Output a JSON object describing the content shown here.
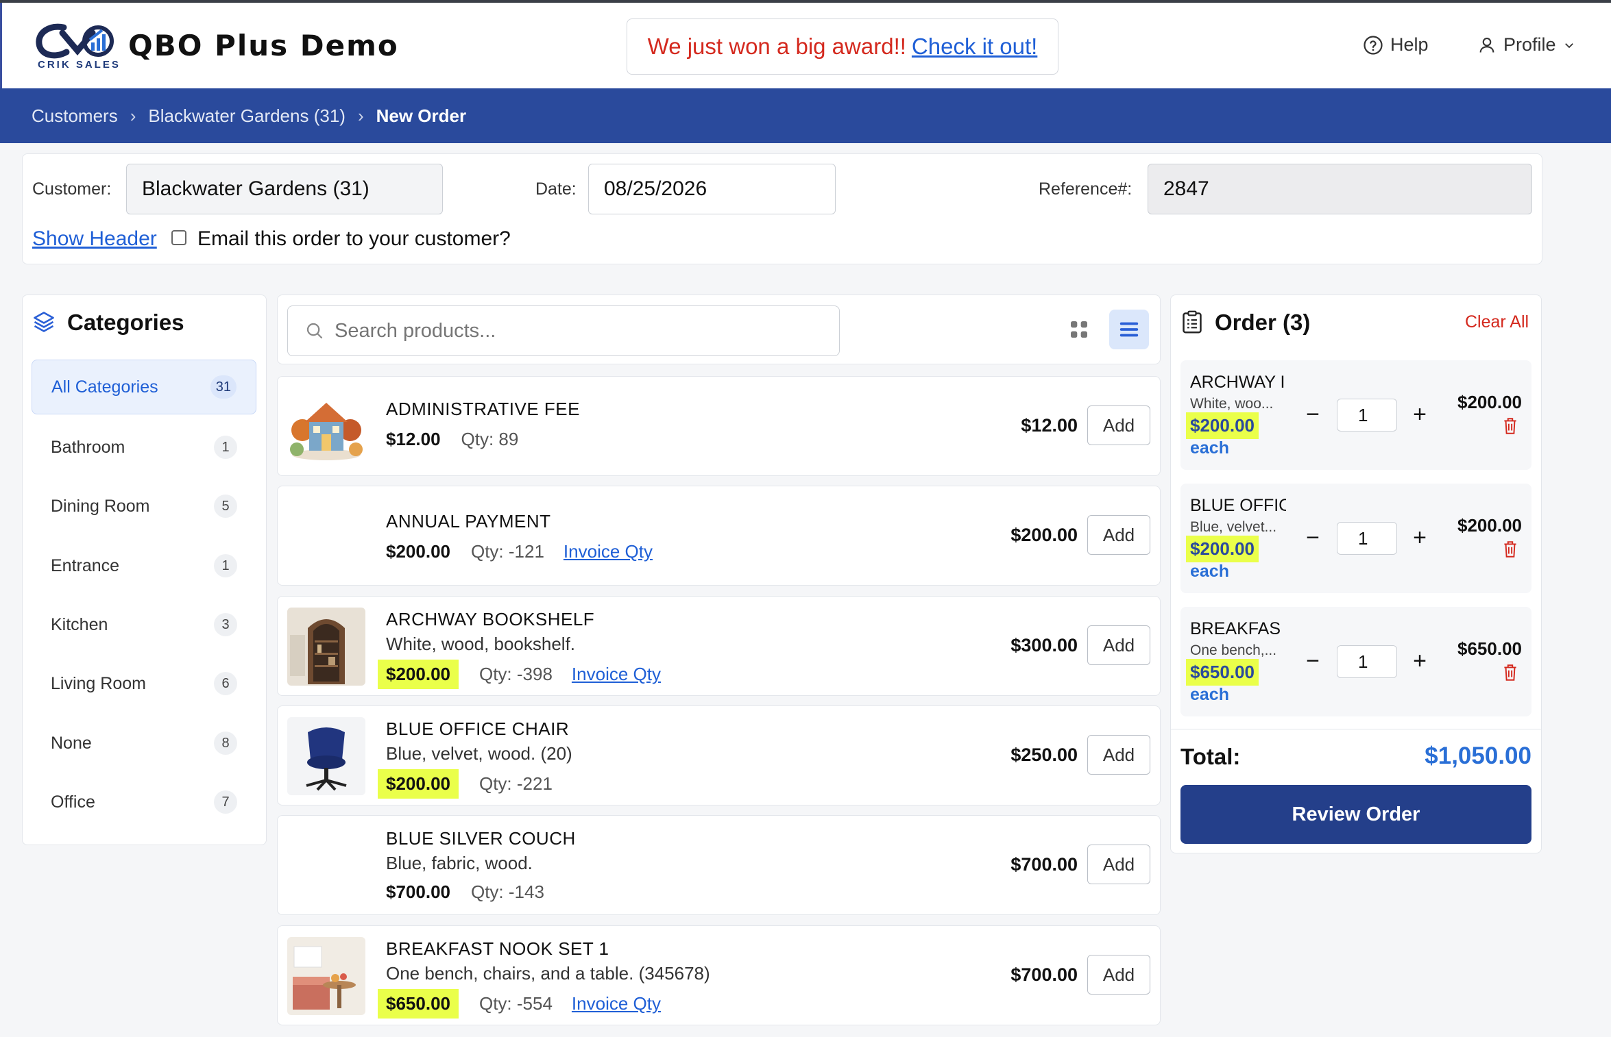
{
  "app": {
    "title": "QBO Plus Demo",
    "logo_text": "CRIK SALES",
    "award_text": "We just won a big award!!",
    "award_link": "Check it out!",
    "help_label": "Help",
    "profile_label": "Profile"
  },
  "breadcrumb": {
    "items": [
      "Customers",
      "Blackwater Gardens (31)",
      "New Order"
    ]
  },
  "order_header": {
    "customer_label": "Customer:",
    "customer_value": "Blackwater Gardens (31)",
    "date_label": "Date:",
    "date_value": "08/25/2026",
    "reference_label": "Reference#:",
    "reference_value": "2847",
    "show_header_link": "Show Header",
    "email_label": "Email this order to your customer?"
  },
  "categories": {
    "title": "Categories",
    "items": [
      {
        "label": "All Categories",
        "count": "31"
      },
      {
        "label": "Bathroom",
        "count": "1"
      },
      {
        "label": "Dining Room",
        "count": "5"
      },
      {
        "label": "Entrance",
        "count": "1"
      },
      {
        "label": "Kitchen",
        "count": "3"
      },
      {
        "label": "Living Room",
        "count": "6"
      },
      {
        "label": "None",
        "count": "8"
      },
      {
        "label": "Office",
        "count": "7"
      }
    ]
  },
  "search": {
    "placeholder": "Search products..."
  },
  "products": [
    {
      "name": "ADMINISTRATIVE FEE",
      "desc": "",
      "price": "$12.00",
      "qty": "Qty: 89",
      "invoice": "",
      "list_price": "$12.00",
      "add": "Add"
    },
    {
      "name": "ANNUAL PAYMENT",
      "desc": "",
      "price": "$200.00",
      "qty": "Qty: -121",
      "invoice": "Invoice Qty",
      "list_price": "$200.00",
      "add": "Add"
    },
    {
      "name": "ARCHWAY BOOKSHELF",
      "desc": "White, wood, bookshelf.",
      "price": "$200.00",
      "qty": "Qty: -398",
      "invoice": "Invoice Qty",
      "list_price": "$300.00",
      "add": "Add"
    },
    {
      "name": "BLUE OFFICE CHAIR",
      "desc": "Blue, velvet, wood. (20)",
      "price": "$200.00",
      "qty": "Qty: -221",
      "invoice": "",
      "list_price": "$250.00",
      "add": "Add"
    },
    {
      "name": "BLUE SILVER COUCH",
      "desc": "Blue, fabric, wood.",
      "price": "$700.00",
      "qty": "Qty: -143",
      "invoice": "",
      "list_price": "$700.00",
      "add": "Add"
    },
    {
      "name": "BREAKFAST NOOK SET 1",
      "desc": "One bench, chairs, and a table. (345678)",
      "price": "$650.00",
      "qty": "Qty: -554",
      "invoice": "Invoice Qty",
      "list_price": "$700.00",
      "add": "Add"
    }
  ],
  "order": {
    "title": "Order (3)",
    "clear_all": "Clear All",
    "items": [
      {
        "name": "ARCHWAY I",
        "desc": "White, woo...",
        "price": "$200.00",
        "each": "each",
        "qty": "1",
        "line_total": "$200.00"
      },
      {
        "name": "BLUE OFFIC",
        "desc": "Blue, velvet...",
        "price": "$200.00",
        "each": "each",
        "qty": "1",
        "line_total": "$200.00"
      },
      {
        "name": "BREAKFAS",
        "desc": "One bench,...",
        "price": "$650.00",
        "each": "each",
        "qty": "1",
        "line_total": "$650.00"
      }
    ],
    "total_label": "Total:",
    "total_value": "$1,050.00",
    "review_button": "Review Order"
  },
  "colors": {
    "brand_blue": "#2a4a9c",
    "link_blue": "#1f5fd6",
    "highlight": "#eaff4a",
    "danger": "#d4291e"
  }
}
